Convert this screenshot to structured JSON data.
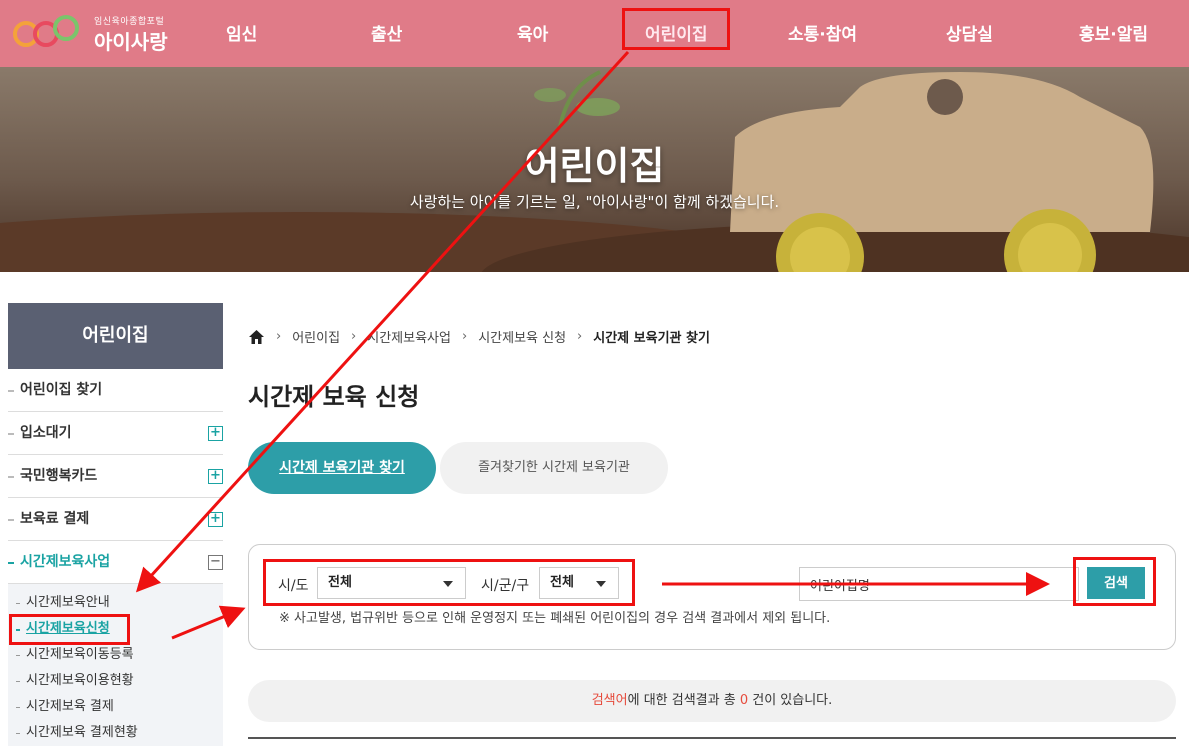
{
  "header": {
    "logo_sub": "임신육아종합포털",
    "logo_main": "아이사랑",
    "nav": [
      "임신",
      "출산",
      "육아",
      "어린이집",
      "소통·참여",
      "상담실",
      "홍보·알림"
    ],
    "active_nav": "어린이집"
  },
  "hero": {
    "title": "어린이집",
    "subtitle": "사랑하는 아이를 기르는 일, \"아이사랑\"이 함께 하겠습니다."
  },
  "sidebar": {
    "title": "어린이집",
    "items": [
      {
        "label": "어린이집 찾기"
      },
      {
        "label": "입소대기",
        "expand": "+"
      },
      {
        "label": "국민행복카드",
        "expand": "+"
      },
      {
        "label": "보육료 결제",
        "expand": "+"
      },
      {
        "label": "시간제보육사업",
        "expand": "−"
      }
    ],
    "sub_items": [
      "시간제보육안내",
      "시간제보육신청",
      "시간제보육이동등록",
      "시간제보육이용현황",
      "시간제보육 결제",
      "시간제보육 결제현황"
    ],
    "current_sub": "시간제보육신청"
  },
  "breadcrumb": [
    "어린이집",
    "시간제보육사업",
    "시간제보육 신청",
    "시간제 보육기관 찾기"
  ],
  "page_title": "시간제 보육 신청",
  "tabs": {
    "active": "시간제 보육기관 찾기",
    "inactive": "즐겨찾기한 시간제 보육기관"
  },
  "search": {
    "sido_label": "시/도",
    "sido_value": "전체",
    "sigungu_label": "시/군/구",
    "sigungu_value": "전체",
    "name_value": "어린이집명",
    "button": "검색",
    "notice": "※ 사고발생, 법규위반 등으로 인해 운영정지 또는 폐쇄된 어린이집의 경우 검색 결과에서 제외 됩니다."
  },
  "result": {
    "keyword": "검색어",
    "text_before_count": "에 대한 검색결과 총 ",
    "count": "0",
    "text_after_count": " 건이 있습니다."
  },
  "colors": {
    "header_bg": "#e07b88",
    "accent": "#2d9ea8",
    "sidebar_head": "#5a6072",
    "annotation": "#ee1111"
  }
}
